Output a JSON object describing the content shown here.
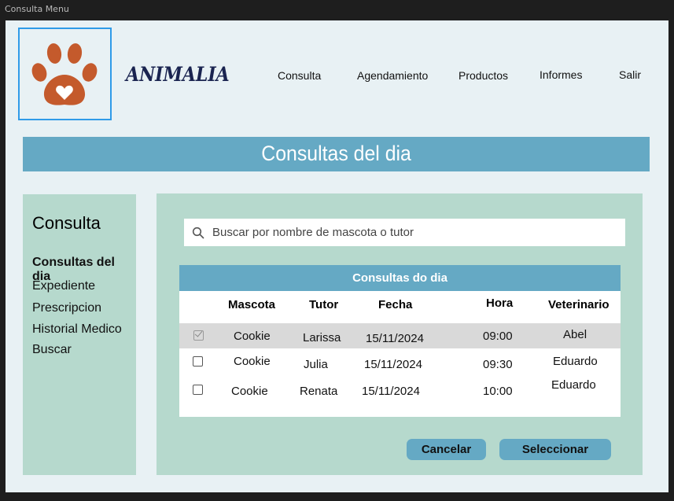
{
  "window": {
    "title": "Consulta Menu"
  },
  "brand": {
    "name": "ANIMALIA"
  },
  "colors": {
    "accent": "#65a9c4",
    "panel": "#b6d9cd",
    "paw": "#c45a2c",
    "background": "#e8f1f4"
  },
  "nav": {
    "consulta": "Consulta",
    "agendamiento": "Agendamiento",
    "productos": "Productos",
    "informes": "Informes",
    "salir": "Salir"
  },
  "banner": {
    "title": "Consultas del dia"
  },
  "sidebar": {
    "title": "Consulta",
    "items": [
      {
        "label": "Consultas del dia",
        "active": true
      },
      {
        "label": "Expediente"
      },
      {
        "label": "Prescripcion"
      },
      {
        "label": "Historial Medico"
      },
      {
        "label": "Buscar"
      }
    ]
  },
  "search": {
    "placeholder": "Buscar por nombre de mascota o tutor",
    "icon": "search-icon"
  },
  "table": {
    "title": "Consultas do dia",
    "columns": [
      "Mascota",
      "Tutor",
      "Fecha",
      "Hora",
      "Veterinario"
    ],
    "rows": [
      {
        "selected": true,
        "mascota": "Cookie",
        "tutor": "Larissa",
        "fecha": "15/11/2024",
        "hora": "09:00",
        "veterinario": "Abel"
      },
      {
        "selected": false,
        "mascota": "Cookie",
        "tutor": "Julia",
        "fecha": "15/11/2024",
        "hora": "09:30",
        "veterinario": "Eduardo"
      },
      {
        "selected": false,
        "mascota": "Cookie",
        "tutor": "Renata",
        "fecha": "15/11/2024",
        "hora": "10:00",
        "veterinario": "Eduardo"
      }
    ]
  },
  "actions": {
    "cancel": "Cancelar",
    "select": "Seleccionar"
  }
}
